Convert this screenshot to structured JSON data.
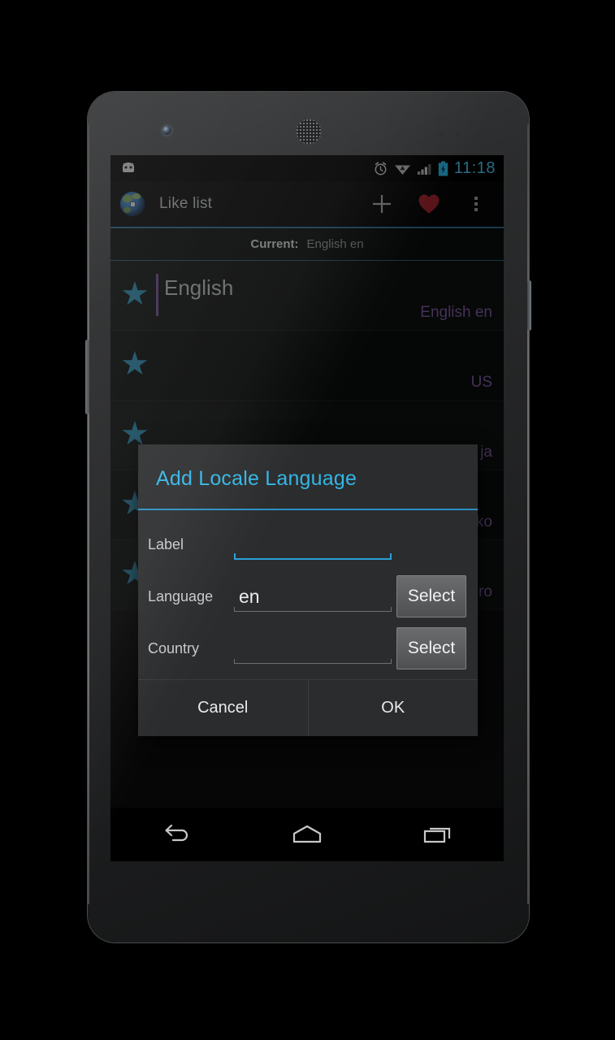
{
  "status_bar": {
    "notification_icon": "android-jellybean-icon",
    "icons": [
      "alarm-icon",
      "wifi-icon",
      "signal-icon",
      "battery-charging-icon"
    ],
    "time": "11:18",
    "time_color": "#4ec3ef"
  },
  "action_bar": {
    "app_icon": "globe-icon",
    "title": "Like list",
    "actions": [
      {
        "name": "add-button",
        "icon": "plus-icon"
      },
      {
        "name": "favorite-button",
        "icon": "heart-icon",
        "color": "#a0242c"
      },
      {
        "name": "overflow-button",
        "icon": "overflow-menu-icon"
      }
    ]
  },
  "current_strip": {
    "label": "Current:",
    "value": "English en"
  },
  "list": {
    "rows": [
      {
        "title": "English",
        "sub": "English en"
      },
      {
        "title": "",
        "sub": "US"
      },
      {
        "title": "",
        "sub": "e ja"
      },
      {
        "title": "",
        "sub": "ko"
      },
      {
        "title": "",
        "sub": "ro"
      }
    ]
  },
  "dialog": {
    "title": "Add Locale Language",
    "title_color": "#33b5e5",
    "fields": [
      {
        "label": "Label",
        "value": "",
        "placeholder": "",
        "focused": true,
        "has_select": false,
        "select_label": ""
      },
      {
        "label": "Language",
        "value": "en",
        "placeholder": "",
        "focused": false,
        "has_select": true,
        "select_label": "Select"
      },
      {
        "label": "Country",
        "value": "",
        "placeholder": "",
        "focused": false,
        "has_select": true,
        "select_label": "Select"
      }
    ],
    "cancel_label": "Cancel",
    "ok_label": "OK"
  },
  "nav_bar": {
    "buttons": [
      {
        "name": "nav-back-button",
        "icon": "back-arrow-icon"
      },
      {
        "name": "nav-home-button",
        "icon": "home-icon"
      },
      {
        "name": "nav-recents-button",
        "icon": "recents-icon"
      }
    ]
  }
}
